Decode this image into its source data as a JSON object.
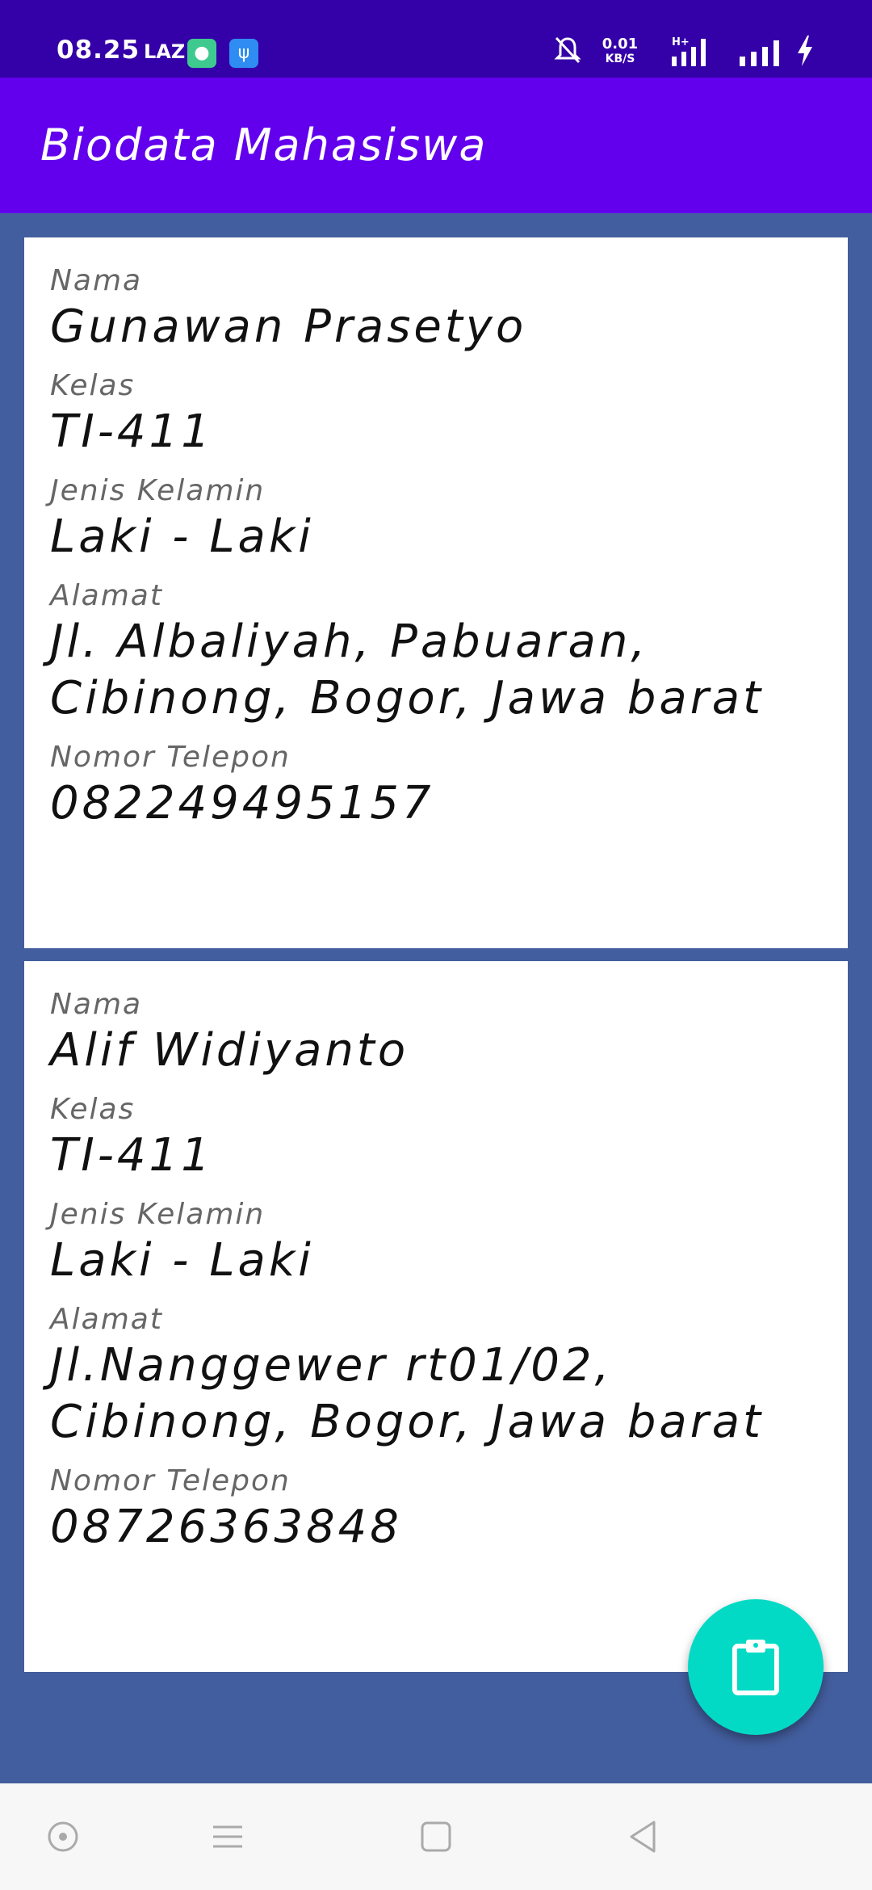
{
  "status_bar": {
    "time": "08.25",
    "carrier_badge": "LAZ",
    "net_speed_value": "0.01",
    "net_speed_unit": "KB/S",
    "network_type": "H+",
    "icons": [
      "chat-app-icon",
      "usb-icon",
      "mute-bell-icon",
      "signal-icon",
      "signal-icon",
      "charging-icon"
    ]
  },
  "app_bar": {
    "title": "Biodata Mahasiswa"
  },
  "labels": {
    "nama": "Nama",
    "kelas": "Kelas",
    "jenis_kelamin": "Jenis Kelamin",
    "alamat": "Alamat",
    "telepon": "Nomor Telepon"
  },
  "students": [
    {
      "nama": "Gunawan Prasetyo",
      "kelas": "TI-411",
      "jenis_kelamin": "Laki - Laki",
      "alamat": "Jl. Albaliyah, Pabuaran, Cibinong, Bogor, Jawa barat",
      "telepon": "082249495157"
    },
    {
      "nama": "Alif Widiyanto",
      "kelas": "TI-411",
      "jenis_kelamin": "Laki - Laki",
      "alamat": "Jl.Nanggewer rt01/02, Cibinong, Bogor, Jawa barat",
      "telepon": "08726363848"
    }
  ],
  "fab": {
    "icon": "clipboard-icon"
  },
  "nav_bar": {
    "icons": [
      "assistant-icon",
      "menu-icon",
      "home-square-icon",
      "back-triangle-icon"
    ]
  },
  "colors": {
    "status_bar": "#3400a7",
    "app_bar": "#6200ee",
    "background": "#435e9e",
    "fab": "#03dac5"
  }
}
